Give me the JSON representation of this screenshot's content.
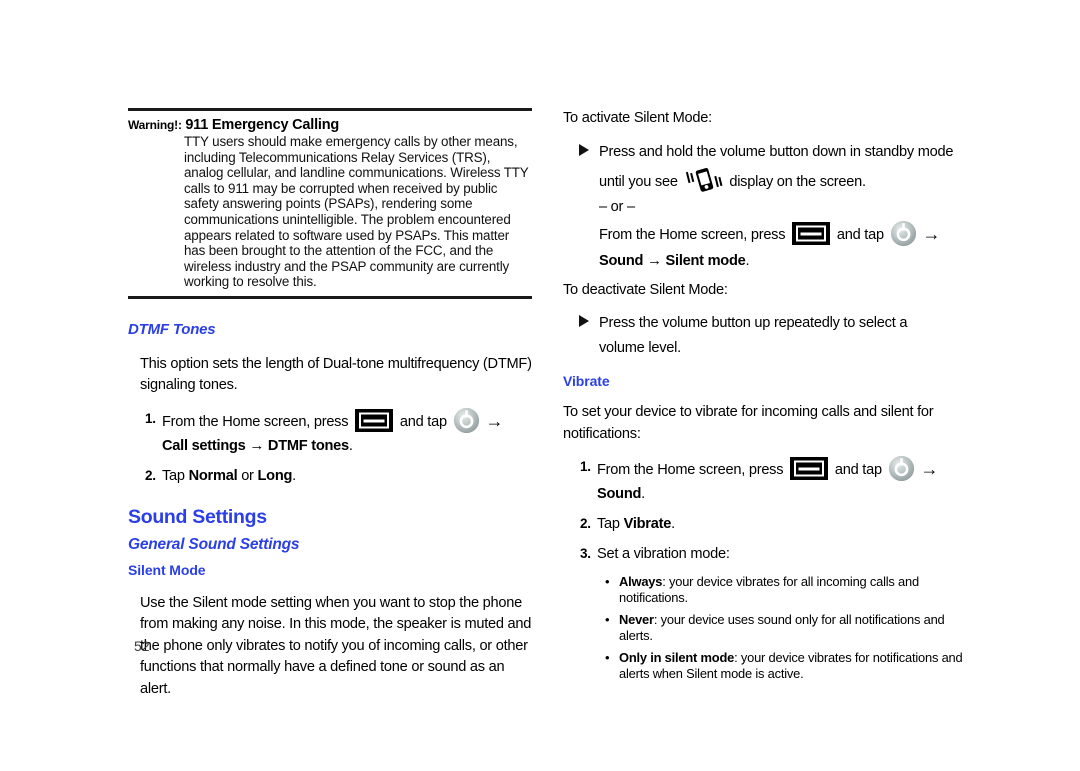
{
  "page": {
    "number": "52",
    "accent_color": "#2b3fe8",
    "rule_color": "#1a1a1a"
  },
  "left_column": {
    "warning": {
      "label": "Warning!:",
      "title": "911 Emergency Calling",
      "body": "TTY users should make emergency calls by other means, including Telecommunications Relay Services (TRS), analog cellular, and landline communications. Wireless TTY calls to 911 may be corrupted when received by public safety answering points (PSAPs), rendering some communications unintelligible. The problem encountered appears related to software used by PSAPs. This matter has been brought to the attention of the FCC, and the wireless industry and the PSAP community are currently working to resolve this."
    },
    "dtmf": {
      "heading": "DTMF Tones",
      "intro": "This option sets the length of Dual-tone multifrequency (DTMF) signaling tones.",
      "step1": {
        "num": "1.",
        "text_before": "From the Home screen, press",
        "text_mid": "and tap",
        "menu_icon": "menu-key-icon",
        "settings_icon": "settings-gear-icon",
        "arrow": "→",
        "path_a": "Call settings",
        "path_arrow": "→",
        "path_b": "DTMF tones",
        "period": "."
      },
      "step2": {
        "num": "2.",
        "text_before": "Tap",
        "option_a": "Normal",
        "conjunction": "or",
        "option_b": "Long",
        "period": "."
      }
    },
    "sound_settings": {
      "chapter_heading": "Sound Settings",
      "section_heading": "General Sound Settings",
      "sub_heading": "Silent Mode",
      "body": "Use the Silent mode setting when you want to stop the phone from making any noise. In this mode, the speaker is muted and the phone only vibrates to notify you of incoming calls, or other functions that normally have a defined tone or sound as an alert."
    }
  },
  "right_column": {
    "activate": {
      "intro": "To activate Silent Mode:",
      "bullet_line1": "Press and hold the volume button down in standby mode",
      "bullet_line2_before": "until you see",
      "bullet_line2_after": "display on the screen.",
      "vibrate_icon": "vibrate-phone-icon",
      "or_separator": "– or –",
      "alt_before": "From the Home screen, press",
      "alt_mid": "and tap",
      "menu_icon": "menu-key-icon",
      "settings_icon": "settings-gear-icon",
      "arrow": "→",
      "path_a": "Sound",
      "path_arrow": "→",
      "path_b": "Silent mode",
      "period": "."
    },
    "deactivate": {
      "intro": "To deactivate Silent Mode:",
      "bullet_line1": "Press the volume button up repeatedly to select a",
      "bullet_line2": "volume level."
    },
    "vibrate": {
      "heading": "Vibrate",
      "intro": "To set your device to vibrate for incoming calls and silent for notifications:",
      "step1": {
        "num": "1.",
        "text_before": "From the Home screen, press",
        "text_mid": "and tap",
        "menu_icon": "menu-key-icon",
        "settings_icon": "settings-gear-icon",
        "arrow": "→",
        "path_a": "Sound",
        "period": "."
      },
      "step2": {
        "num": "2.",
        "text_before": "Tap",
        "option": "Vibrate",
        "period": "."
      },
      "step3": {
        "num": "3.",
        "text": "Set a vibration mode:"
      },
      "options": [
        {
          "bullet": "•",
          "name": "Always",
          "desc": ": your device vibrates for all incoming calls and notifications."
        },
        {
          "bullet": "•",
          "name": "Never",
          "desc": ": your device uses sound only for all notifications and alerts."
        },
        {
          "bullet": "•",
          "name": "Only in silent mode",
          "desc": ": your device vibrates for notifications and alerts when Silent mode is active."
        }
      ]
    }
  }
}
